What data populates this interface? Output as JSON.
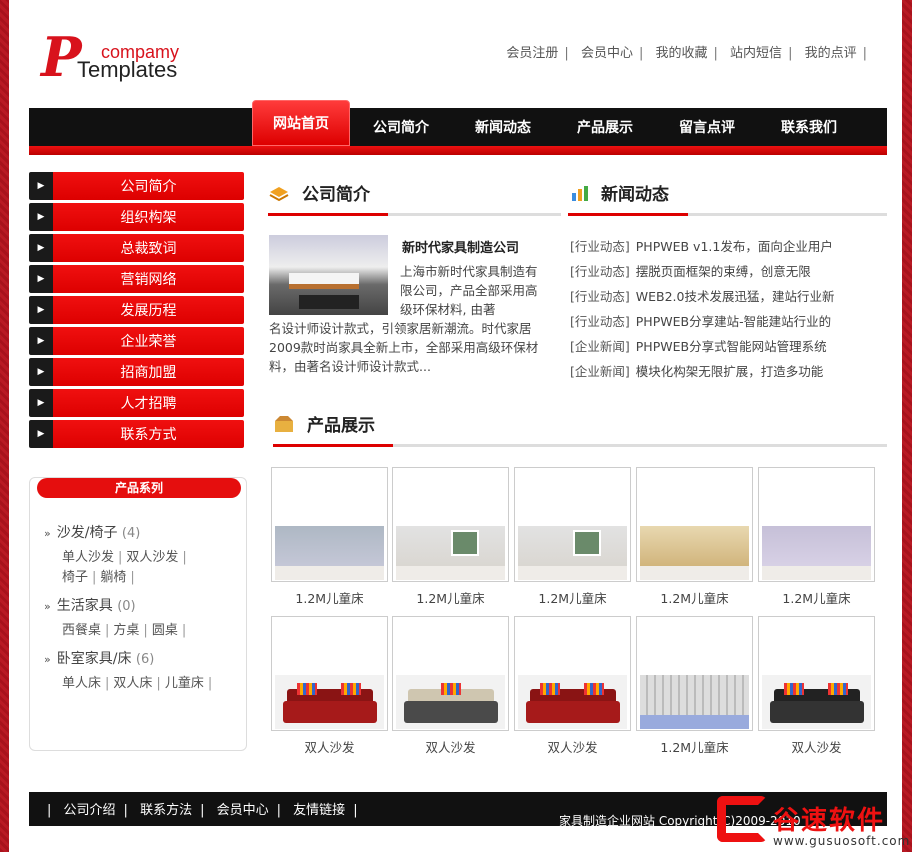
{
  "logo": {
    "mark": "P",
    "line1": "compamy",
    "line2": "Templates"
  },
  "toplinks": [
    "会员注册",
    "会员中心",
    "我的收藏",
    "站内短信",
    "我的点评"
  ],
  "separator": "|",
  "nav": [
    "网站首页",
    "公司简介",
    "新闻动态",
    "产品展示",
    "留言点评",
    "联系我们"
  ],
  "sidebar": [
    "公司简介",
    "组织构架",
    "总裁致词",
    "营销网络",
    "发展历程",
    "企业荣誉",
    "招商加盟",
    "人才招聘",
    "联系方式"
  ],
  "categories": {
    "title": "产品系列",
    "groups": [
      {
        "name": "沙发/椅子",
        "count": "(4)",
        "subs": [
          "单人沙发",
          "双人沙发",
          "椅子",
          "躺椅"
        ]
      },
      {
        "name": "生活家具",
        "count": "(0)",
        "subs": [
          "西餐桌",
          "方桌",
          "圆桌"
        ]
      },
      {
        "name": "卧室家具/床",
        "count": "(6)",
        "subs": [
          "单人床",
          "双人床",
          "儿童床"
        ]
      }
    ]
  },
  "about": {
    "heading": "公司简介",
    "title": "新时代家具制造公司",
    "text_first": "上海市新时代家具制造有限公司，产品全部采用高级环保材料, 由著",
    "text_rest": "名设计师设计款式，引领家居新潮流。时代家居2009款时尚家具全新上市，全部采用高级环保材料，由著名设计师设计款式..."
  },
  "news": {
    "heading": "新闻动态",
    "items": [
      {
        "cat": "[行业动态]",
        "title": "PHPWEB v1.1发布，面向企业用户"
      },
      {
        "cat": "[行业动态]",
        "title": "摆脱页面框架的束缚，创意无限"
      },
      {
        "cat": "[行业动态]",
        "title": "WEB2.0技术发展迅猛，建站行业新"
      },
      {
        "cat": "[行业动态]",
        "title": "PHPWEB分享建站-智能建站行业的"
      },
      {
        "cat": "[企业新闻]",
        "title": "PHPWEB分享式智能网站管理系统"
      },
      {
        "cat": "[企业新闻]",
        "title": "模块化构架无限扩展，打造多功能"
      }
    ]
  },
  "products": {
    "heading": "产品展示",
    "items": [
      "1.2M儿童床",
      "1.2M儿童床",
      "1.2M儿童床",
      "1.2M儿童床",
      "1.2M儿童床",
      "双人沙发",
      "双人沙发",
      "双人沙发",
      "1.2M儿童床",
      "双人沙发"
    ]
  },
  "footer": {
    "links": [
      "公司介绍",
      "联系方法",
      "会员中心",
      "友情链接"
    ],
    "copyright": "家具制造企业网站 Copyright(C)2009-2010"
  },
  "watermark": {
    "text": "谷速软件",
    "url": "www.gusuosoft.com"
  },
  "colors": {
    "accent": "#d8121c",
    "dark": "#111111"
  }
}
